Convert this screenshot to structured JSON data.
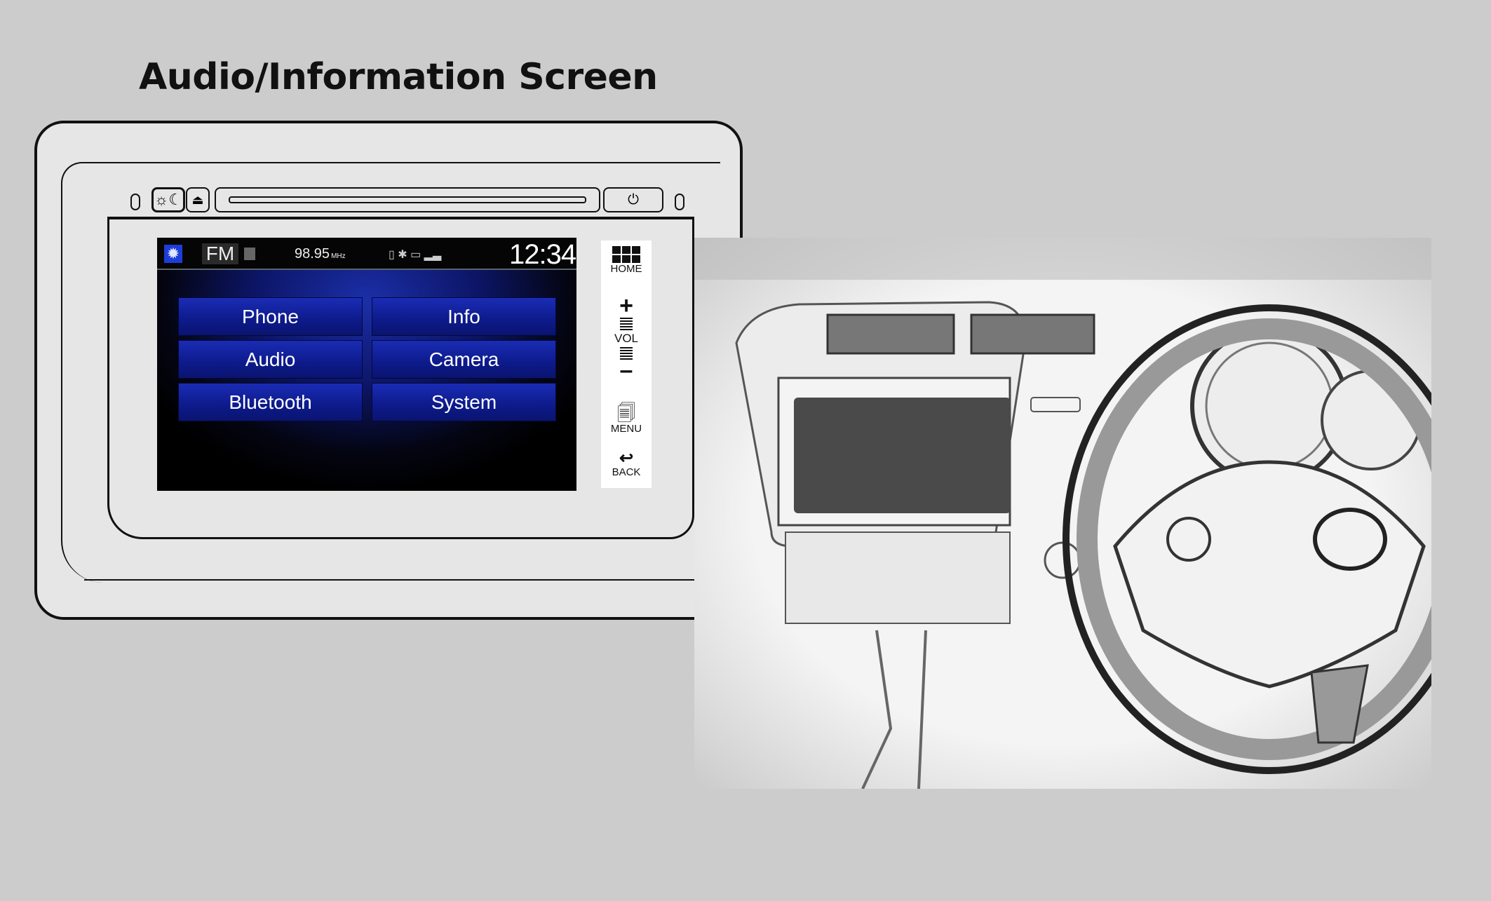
{
  "title": "Audio/Information Screen",
  "head_unit": {
    "day_night_button_icon": "sun-moon-icon",
    "eject_button_icon": "eject-icon",
    "power_button_icon": "power-icon"
  },
  "screen": {
    "status": {
      "source": "FM",
      "frequency": "98.95",
      "frequency_unit": "MHz",
      "time": "12:34"
    },
    "menu": [
      {
        "label": "Phone"
      },
      {
        "label": "Info"
      },
      {
        "label": "Audio"
      },
      {
        "label": "Camera"
      },
      {
        "label": "Bluetooth"
      },
      {
        "label": "System"
      }
    ]
  },
  "side_buttons": {
    "home": "HOME",
    "vol": "VOL",
    "menu": "MENU",
    "back": "BACK"
  },
  "colors": {
    "menu_button": "#0d1a8a",
    "background": "#cccccc"
  }
}
